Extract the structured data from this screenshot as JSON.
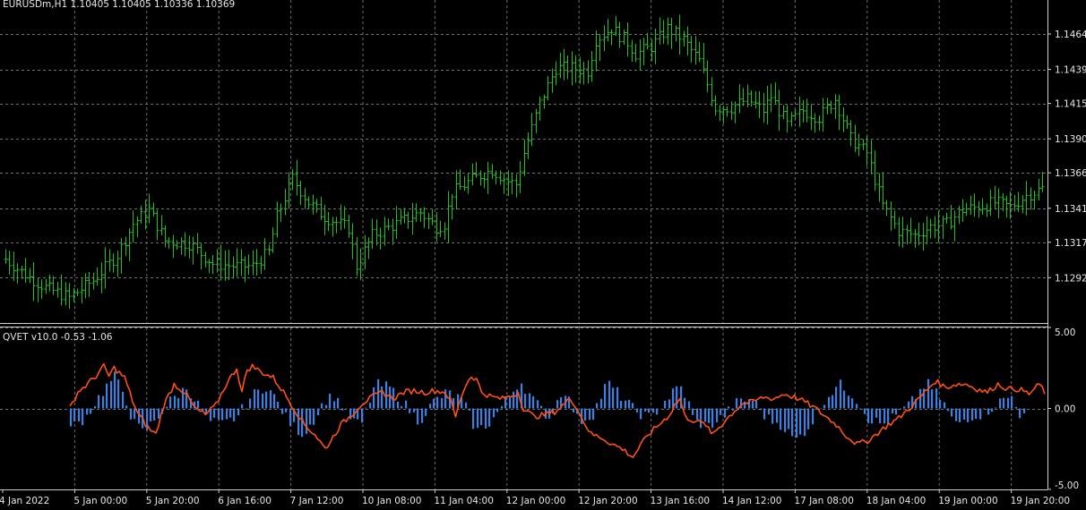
{
  "colors": {
    "background": "#000000",
    "grid": "#6e6e6e",
    "frame": "#cfcfcf",
    "candle": "#1fc01f",
    "histogram": "#3f7fe0",
    "signal_line": "#ff5019"
  },
  "chart_data": [
    {
      "type": "ohlc",
      "title": "EURUSDm,H1  1.10405 1.10405 1.10336 1.10369",
      "y_ticks": [
        "1.1464",
        "1.1439",
        "1.1415",
        "1.1390",
        "1.1366",
        "1.1341",
        "1.1317",
        "1.1292"
      ],
      "ylim": [
        1.126,
        1.1488
      ],
      "grid": true,
      "keypoints": [
        [
          0,
          1.1305
        ],
        [
          6,
          1.1292
        ],
        [
          10,
          1.1285
        ],
        [
          16,
          1.1278
        ],
        [
          22,
          1.129
        ],
        [
          28,
          1.1308
        ],
        [
          32,
          1.133
        ],
        [
          36,
          1.134
        ],
        [
          40,
          1.1318
        ],
        [
          46,
          1.1316
        ],
        [
          52,
          1.1302
        ],
        [
          58,
          1.13
        ],
        [
          62,
          1.13
        ],
        [
          66,
          1.131
        ],
        [
          68,
          1.1335
        ],
        [
          72,
          1.1362
        ],
        [
          76,
          1.1345
        ],
        [
          80,
          1.1335
        ],
        [
          86,
          1.1327
        ],
        [
          88,
          1.13
        ],
        [
          92,
          1.1322
        ],
        [
          98,
          1.133
        ],
        [
          104,
          1.1338
        ],
        [
          108,
          1.1328
        ],
        [
          110,
          1.133
        ],
        [
          112,
          1.1352
        ],
        [
          118,
          1.1363
        ],
        [
          122,
          1.1368
        ],
        [
          126,
          1.136
        ],
        [
          128,
          1.1358
        ],
        [
          130,
          1.138
        ],
        [
          134,
          1.1415
        ],
        [
          138,
          1.144
        ],
        [
          142,
          1.144
        ],
        [
          146,
          1.1438
        ],
        [
          148,
          1.146
        ],
        [
          152,
          1.1468
        ],
        [
          156,
          1.1458
        ],
        [
          158,
          1.145
        ],
        [
          162,
          1.1455
        ],
        [
          166,
          1.1468
        ],
        [
          170,
          1.146
        ],
        [
          174,
          1.1445
        ],
        [
          178,
          1.1412
        ],
        [
          182,
          1.1412
        ],
        [
          186,
          1.1418
        ],
        [
          190,
          1.141
        ],
        [
          192,
          1.142
        ],
        [
          196,
          1.14
        ],
        [
          200,
          1.141
        ],
        [
          204,
          1.1405
        ],
        [
          208,
          1.1418
        ],
        [
          212,
          1.139
        ],
        [
          216,
          1.138
        ],
        [
          220,
          1.1343
        ],
        [
          224,
          1.1325
        ],
        [
          228,
          1.1322
        ],
        [
          232,
          1.1328
        ],
        [
          236,
          1.133
        ],
        [
          240,
          1.134
        ],
        [
          244,
          1.1342
        ],
        [
          248,
          1.1345
        ],
        [
          252,
          1.1342
        ],
        [
          256,
          1.135
        ],
        [
          260,
          1.1355
        ],
        [
          262,
          1.136
        ]
      ]
    },
    {
      "type": "histogram+line",
      "title": "QVET v10.0 -0.53 -1.06",
      "y_ticks": [
        "5.00",
        "0.00",
        "-5.00"
      ],
      "ylim": [
        -5.0,
        5.0
      ],
      "grid": true,
      "histogram_keypoints": [
        [
          0,
          -1.2
        ],
        [
          4,
          -0.6
        ],
        [
          8,
          0.8
        ],
        [
          12,
          2.0
        ],
        [
          15,
          0.8
        ],
        [
          17,
          -0.8
        ],
        [
          20,
          -1.5
        ],
        [
          24,
          -0.5
        ],
        [
          28,
          0.6
        ],
        [
          32,
          1.3
        ],
        [
          35,
          0.3
        ],
        [
          38,
          -0.8
        ],
        [
          42,
          -1.0
        ],
        [
          46,
          -0.5
        ],
        [
          50,
          0.8
        ],
        [
          54,
          1.4
        ],
        [
          57,
          0.4
        ],
        [
          60,
          -0.8
        ],
        [
          64,
          -1.6
        ],
        [
          68,
          -0.4
        ],
        [
          70,
          0.5
        ],
        [
          73,
          0.8
        ],
        [
          76,
          -0.4
        ],
        [
          80,
          -1.1
        ],
        [
          84,
          1.5
        ],
        [
          88,
          1.3
        ],
        [
          92,
          0.3
        ],
        [
          96,
          -0.8
        ],
        [
          100,
          0.4
        ],
        [
          104,
          1.0
        ],
        [
          108,
          0.5
        ],
        [
          112,
          -1.4
        ],
        [
          116,
          -0.8
        ],
        [
          120,
          0.5
        ],
        [
          124,
          1.7
        ],
        [
          128,
          0.4
        ],
        [
          132,
          -0.6
        ],
        [
          136,
          1.3
        ],
        [
          140,
          -0.8
        ],
        [
          144,
          -0.4
        ],
        [
          148,
          1.6
        ],
        [
          152,
          0.7
        ],
        [
          156,
          -0.2
        ],
        [
          160,
          -0.6
        ],
        [
          164,
          0.5
        ],
        [
          168,
          1.4
        ],
        [
          170,
          0.6
        ],
        [
          172,
          -0.8
        ],
        [
          176,
          -1.1
        ],
        [
          180,
          -0.5
        ],
        [
          184,
          0.4
        ],
        [
          188,
          0.6
        ],
        [
          192,
          -0.6
        ],
        [
          196,
          -1.0
        ],
        [
          200,
          -2.0
        ],
        [
          204,
          -1.0
        ],
        [
          208,
          0.6
        ],
        [
          212,
          1.5
        ],
        [
          216,
          0.8
        ],
        [
          220,
          -0.6
        ],
        [
          224,
          -1.0
        ],
        [
          228,
          -0.4
        ],
        [
          232,
          0.4
        ],
        [
          236,
          1.6
        ],
        [
          240,
          0.6
        ],
        [
          244,
          -1.0
        ],
        [
          248,
          -0.5
        ],
        [
          252,
          -0.3
        ],
        [
          256,
          0.4
        ],
        [
          260,
          0.8
        ],
        [
          262,
          -0.5
        ]
      ],
      "line_keypoints": [
        [
          0,
          0.0
        ],
        [
          3,
          1.0
        ],
        [
          6,
          1.4
        ],
        [
          10,
          2.0
        ],
        [
          13,
          2.6
        ],
        [
          15,
          2.0
        ],
        [
          17,
          2.5
        ],
        [
          21,
          1.9
        ],
        [
          24,
          0.5
        ],
        [
          26,
          -0.3
        ],
        [
          30,
          -1.2
        ],
        [
          33,
          -1.6
        ],
        [
          36,
          0.2
        ],
        [
          40,
          1.5
        ],
        [
          44,
          1.0
        ],
        [
          48,
          0.0
        ],
        [
          52,
          -0.4
        ],
        [
          56,
          0.2
        ],
        [
          60,
          1.5
        ],
        [
          64,
          2.5
        ],
        [
          66,
          1.0
        ],
        [
          68,
          2.4
        ],
        [
          70,
          2.6
        ],
        [
          74,
          2.2
        ],
        [
          78,
          1.9
        ],
        [
          82,
          1.0
        ],
        [
          86,
          0.0
        ],
        [
          90,
          -1.0
        ],
        [
          94,
          -1.6
        ],
        [
          98,
          -2.5
        ],
        [
          100,
          -2.0
        ],
        [
          104,
          -1.0
        ],
        [
          108,
          -0.4
        ],
        [
          112,
          0.3
        ],
        [
          116,
          0.7
        ],
        [
          120,
          1.0
        ],
        [
          124,
          0.6
        ],
        [
          128,
          1.0
        ],
        [
          132,
          1.1
        ],
        [
          136,
          1.0
        ],
        [
          140,
          1.1
        ],
        [
          144,
          1.0
        ],
        [
          146,
          0.5
        ],
        [
          148,
          -0.5
        ],
        [
          150,
          0.7
        ],
        [
          152,
          1.5
        ],
        [
          154,
          2.0
        ],
        [
          156,
          1.8
        ],
        [
          158,
          1.0
        ],
        [
          162,
          0.7
        ],
        [
          166,
          0.6
        ],
        [
          170,
          0.8
        ],
        [
          172,
          1.0
        ],
        [
          174,
          0.0
        ],
        [
          178,
          -0.5
        ],
        [
          182,
          -0.4
        ],
        [
          186,
          -0.2
        ],
        [
          190,
          0.3
        ],
        [
          192,
          0.6
        ],
        [
          194,
          0.2
        ],
        [
          196,
          -0.5
        ],
        [
          200,
          -1.6
        ],
        [
          204,
          -1.8
        ],
        [
          208,
          -2.2
        ],
        [
          212,
          -2.5
        ],
        [
          216,
          -3.0
        ],
        [
          218,
          -2.5
        ],
        [
          222,
          -1.6
        ],
        [
          226,
          -1.0
        ],
        [
          230,
          -0.4
        ],
        [
          232,
          0.2
        ],
        [
          234,
          0.6
        ],
        [
          236,
          -0.5
        ],
        [
          240,
          -0.8
        ],
        [
          244,
          -1.0
        ],
        [
          246,
          -1.6
        ],
        [
          250,
          -1.0
        ],
        [
          254,
          -0.3
        ],
        [
          258,
          0.3
        ],
        [
          262,
          0.4
        ],
        [
          266,
          0.7
        ],
        [
          270,
          0.6
        ],
        [
          274,
          0.9
        ],
        [
          278,
          0.7
        ],
        [
          282,
          0.4
        ],
        [
          286,
          0.0
        ],
        [
          290,
          -0.5
        ],
        [
          294,
          -1.0
        ],
        [
          298,
          -1.7
        ],
        [
          302,
          -2.2
        ],
        [
          306,
          -2.0
        ],
        [
          310,
          -1.5
        ],
        [
          314,
          -1.0
        ],
        [
          318,
          -0.6
        ],
        [
          320,
          -0.3
        ],
        [
          324,
          0.3
        ],
        [
          328,
          1.0
        ],
        [
          332,
          1.7
        ],
        [
          336,
          1.3
        ],
        [
          340,
          1.5
        ],
        [
          344,
          1.5
        ],
        [
          348,
          1.2
        ],
        [
          352,
          1.0
        ],
        [
          356,
          1.5
        ],
        [
          360,
          1.2
        ],
        [
          364,
          1.2
        ],
        [
          368,
          0.9
        ],
        [
          372,
          1.5
        ],
        [
          374,
          1.0
        ]
      ]
    }
  ],
  "x_ticks": [
    "4 Jan 2022",
    "5 Jan 00:00",
    "5 Jan 20:00",
    "6 Jan 16:00",
    "7 Jan 12:00",
    "10 Jan 08:00",
    "11 Jan 04:00",
    "12 Jan 00:00",
    "12 Jan 20:00",
    "13 Jan 16:00",
    "14 Jan 12:00",
    "17 Jan 08:00",
    "18 Jan 04:00",
    "19 Jan 00:00",
    "19 Jan 20:00"
  ]
}
